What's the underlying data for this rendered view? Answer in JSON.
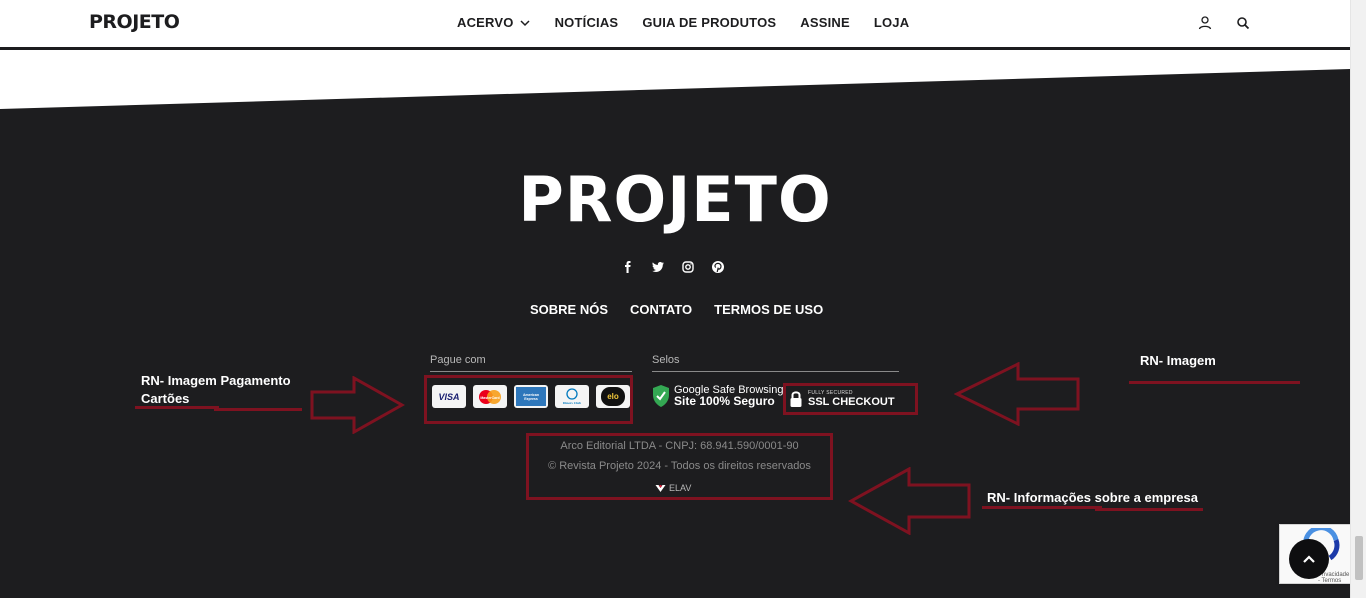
{
  "header": {
    "logo": "PROJETO",
    "nav": [
      {
        "label": "ACERVO"
      },
      {
        "label": "NOTÍCIAS"
      },
      {
        "label": "GUIA DE PRODUTOS"
      },
      {
        "label": "ASSINE"
      },
      {
        "label": "LOJA"
      }
    ],
    "icons": [
      "user-icon",
      "search-icon"
    ]
  },
  "footer": {
    "logo": "PROJETO",
    "social_icons": [
      "facebook-icon",
      "twitter-icon",
      "instagram-icon",
      "pinterest-icon"
    ],
    "links": [
      "SOBRE NÓS",
      "CONTATO",
      "TERMOS DE USO"
    ],
    "payment": {
      "label": "Pague com",
      "cards": [
        "VISA",
        "MasterCard",
        "American Express",
        "Diners Club",
        "elo"
      ]
    },
    "seals": {
      "label": "Selos",
      "google_line1": "Google Safe Browsing",
      "google_line2": "Site 100% Seguro",
      "ssl_small": "FULLY SECURED",
      "ssl_big": "SSL CHECKOUT"
    },
    "company_info": "Arco Editorial LTDA - CNPJ: 68.941.590/0001-90",
    "copyright": "© Revista Projeto 2024 - Todos os direitos reservados",
    "credit": "ELAV"
  },
  "annotations": {
    "payment": "RN- Imagem Pagamento Cartões",
    "image": "RN- Imagem",
    "company": "RN- Informações sobre a empresa"
  },
  "widgets": {
    "recaptcha_text": "Privacidade - Termos"
  },
  "colors": {
    "footer_bg": "#1d1d1f",
    "annotation": "#7e1220",
    "text_dim": "#8a8a8a"
  }
}
